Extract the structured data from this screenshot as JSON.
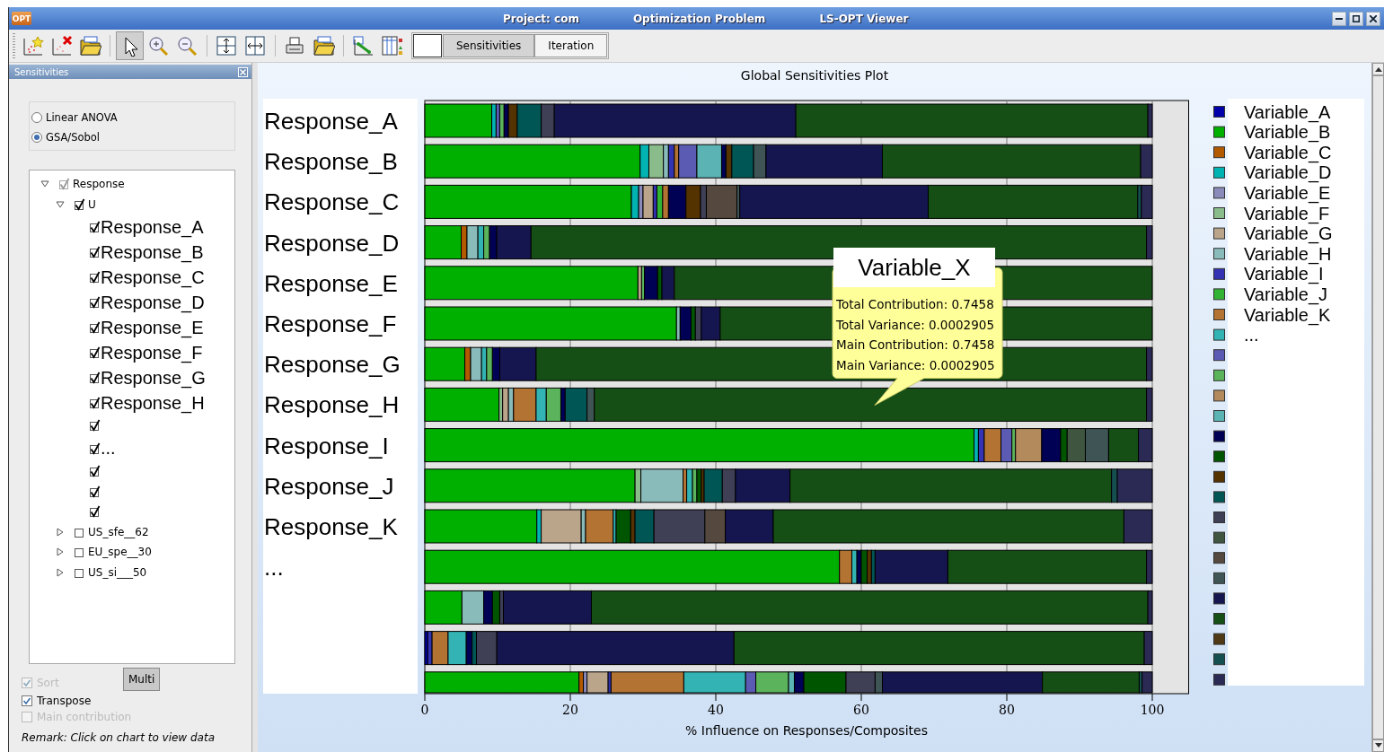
{
  "window": {
    "app_icon": "OPT",
    "title_parts": [
      "Project: com",
      "Optimization Problem",
      "LS-OPT Viewer"
    ]
  },
  "toolbar": {
    "tool_groups": [
      [
        {
          "kind": "add-chart",
          "selected": false
        },
        {
          "kind": "delete-chart",
          "selected": false
        },
        {
          "kind": "open-folder",
          "selected": false
        }
      ],
      [
        {
          "kind": "pointer",
          "selected": true
        },
        {
          "kind": "zoom-in",
          "selected": false
        },
        {
          "kind": "zoom-out",
          "selected": false
        }
      ],
      [
        {
          "kind": "fit-vertical",
          "selected": false
        },
        {
          "kind": "fit-horizontal",
          "selected": false
        }
      ],
      [
        {
          "kind": "print",
          "selected": false
        },
        {
          "kind": "export",
          "selected": false
        }
      ],
      [
        {
          "kind": "graph",
          "selected": false
        },
        {
          "kind": "table",
          "selected": false
        }
      ]
    ],
    "tabs": [
      {
        "label": "Sensitivities",
        "selected": true
      },
      {
        "label": "Iteration",
        "selected": false
      }
    ]
  },
  "side_panel": {
    "title": "Sensitivities",
    "methods": [
      {
        "label": "Linear ANOVA",
        "selected": false
      },
      {
        "label": "GSA/Sobol",
        "selected": true
      }
    ],
    "tree": [
      {
        "label": "Response",
        "checked": true,
        "disabled": true,
        "expanded": true,
        "children": [
          {
            "label": "U",
            "checked": true,
            "disabled": false,
            "expanded": true,
            "children": [
              {
                "label": "Response_A",
                "checked": true
              },
              {
                "label": "Response_B",
                "checked": true
              },
              {
                "label": "Response_C",
                "checked": true
              },
              {
                "label": "Response_D",
                "checked": true
              },
              {
                "label": "Response_E",
                "checked": true
              },
              {
                "label": "Response_F",
                "checked": true
              },
              {
                "label": "Response_G",
                "checked": true
              },
              {
                "label": "Response_H",
                "checked": true
              },
              {
                "checked": true
              },
              {
                "label": "...",
                "checked": true
              },
              {
                "checked": true
              },
              {
                "checked": true
              },
              {
                "checked": true
              }
            ]
          },
          {
            "label": "US_sfe__62",
            "checked": false,
            "disabled": false,
            "expanded": false
          },
          {
            "label": "EU_spe__30",
            "checked": false,
            "disabled": false,
            "expanded": false
          },
          {
            "label": "US_si___50",
            "checked": false,
            "disabled": false,
            "expanded": false
          }
        ]
      }
    ],
    "options": [
      {
        "label": "Sort",
        "checked": true,
        "disabled": true
      },
      {
        "label": "Transpose",
        "checked": true,
        "disabled": false
      },
      {
        "label": "Main contribution",
        "checked": false,
        "disabled": true
      }
    ],
    "multi_button": "Multi",
    "remark": "Remark: Click on chart to view data"
  },
  "plot": {
    "bar_labels": [
      "Response_A",
      "Response_B",
      "Response_C",
      "Response_D",
      "Response_E",
      "Response_F",
      "Response_G",
      "Response_H",
      "Response_I",
      "Response_J",
      "Response_K",
      "..."
    ],
    "chart_data": {
      "type": "bar",
      "orientation": "horizontal",
      "stacked": true,
      "grid": true,
      "legend": "right",
      "title": "Global Sensitivities Plot",
      "xlabel": "% Influence on Responses/Composites",
      "xlim": [
        0,
        105
      ],
      "xticks": [
        0,
        20,
        40,
        60,
        80,
        100
      ],
      "series": [
        {
          "name": "Variable_A",
          "color": "#0000aa",
          "values": [
            0,
            0,
            0,
            0,
            0,
            0,
            0,
            0,
            0,
            0,
            0,
            0,
            0,
            0.4,
            0
          ]
        },
        {
          "name": "Variable_B",
          "color": "#00b000",
          "values": [
            9.2,
            29.6,
            28.4,
            5,
            29.3,
            34.6,
            5.5,
            10.2,
            75.5,
            28.9,
            15.4,
            57,
            5.1,
            0,
            21.2
          ]
        },
        {
          "name": "Variable_C",
          "color": "#b35900",
          "values": [
            0,
            0,
            0,
            0.8,
            0,
            0,
            0.8,
            0,
            0,
            0,
            0,
            0,
            0,
            0,
            0.6
          ]
        },
        {
          "name": "Variable_D",
          "color": "#00b3b3",
          "values": [
            0.6,
            1.2,
            1,
            0,
            0,
            0,
            0,
            0,
            0.6,
            0,
            0.6,
            0,
            0,
            0,
            0
          ]
        },
        {
          "name": "Variable_E",
          "color": "#8a8abb",
          "values": [
            0,
            0,
            0.6,
            0,
            0,
            0,
            0,
            0,
            0,
            0,
            0,
            0,
            0,
            0,
            0.5
          ]
        },
        {
          "name": "Variable_F",
          "color": "#8abb8a",
          "values": [
            0,
            2,
            0,
            0,
            0,
            0,
            0,
            0.5,
            0,
            0.8,
            0,
            0,
            0,
            0,
            0
          ]
        },
        {
          "name": "Variable_G",
          "color": "#bba58a",
          "values": [
            0,
            0,
            1.4,
            0,
            0.5,
            0,
            0,
            0.8,
            0,
            0,
            5.5,
            0,
            0,
            0,
            2.9
          ]
        },
        {
          "name": "Variable_H",
          "color": "#8abbbb",
          "values": [
            0,
            0.7,
            0,
            1.5,
            0,
            0.5,
            1.5,
            0.7,
            0,
            5.8,
            0.6,
            0,
            3,
            0,
            0
          ]
        },
        {
          "name": "Variable_I",
          "color": "#3333b3",
          "values": [
            0,
            0.8,
            0.5,
            0,
            0,
            0,
            0,
            0,
            0.8,
            0,
            0,
            0,
            0,
            0.6,
            0.4
          ]
        },
        {
          "name": "Variable_J",
          "color": "#33b333",
          "values": [
            0,
            0,
            0.8,
            0,
            0,
            0,
            0,
            0,
            0,
            0,
            0,
            0,
            0,
            0,
            0
          ]
        },
        {
          "name": "Variable_K",
          "color": "#b37333",
          "values": [
            0,
            0.6,
            0.8,
            0,
            0,
            0,
            0,
            3.1,
            2.3,
            0.5,
            3.8,
            1.7,
            0,
            2.2,
            10
          ]
        },
        {
          "name": "...",
          "color": "#33b3b3",
          "values": [
            0,
            0,
            0,
            0.8,
            0,
            0,
            0.7,
            1.4,
            0,
            0.8,
            0.4,
            0.7,
            0,
            2.5,
            8.5
          ]
        },
        {
          "color": "#5b5bb3",
          "values": [
            0.5,
            2.5,
            0,
            0,
            0,
            0,
            0,
            0,
            1.5,
            0,
            0,
            0,
            0,
            0,
            1.4
          ]
        },
        {
          "color": "#5bb35b",
          "values": [
            0.6,
            0,
            0,
            0.8,
            0.4,
            0,
            0.8,
            2,
            0.5,
            0.6,
            0,
            0,
            0,
            0,
            4.5
          ]
        },
        {
          "color": "#b38a5b",
          "values": [
            0,
            0,
            0,
            0,
            0,
            0,
            0,
            0,
            3.6,
            0,
            0,
            0,
            0,
            0,
            0
          ]
        },
        {
          "color": "#5bb3b3",
          "values": [
            0,
            3.4,
            0,
            0,
            0,
            0,
            0,
            0,
            0,
            0,
            0,
            0,
            0,
            0,
            0.8
          ]
        },
        {
          "color": "#000055",
          "values": [
            0.6,
            0.6,
            2.4,
            1,
            1.8,
            1.5,
            1,
            0.6,
            2.6,
            0,
            0,
            0.6,
            1.2,
            0.8,
            1.3
          ]
        },
        {
          "color": "#005500",
          "values": [
            0,
            0,
            0,
            0,
            0.6,
            0.6,
            0,
            0,
            0.9,
            0.6,
            2,
            0.8,
            1,
            0,
            5.8
          ]
        },
        {
          "color": "#553300",
          "values": [
            1.2,
            0.8,
            2,
            0,
            0,
            0,
            0,
            0,
            0,
            0.4,
            0.6,
            0.6,
            0,
            0,
            0
          ]
        },
        {
          "color": "#005555",
          "values": [
            3.3,
            3,
            0,
            0,
            0,
            0,
            0,
            3,
            0,
            2.5,
            2.6,
            0.5,
            0,
            0.6,
            0
          ]
        },
        {
          "color": "#3f3f55",
          "values": [
            1.8,
            0,
            0.8,
            0,
            0,
            0.8,
            0,
            0,
            0,
            1.8,
            7,
            0,
            0.5,
            2.8,
            4
          ]
        },
        {
          "color": "#3f553f",
          "values": [
            0,
            0,
            0,
            0,
            0,
            0,
            0,
            0,
            2.5,
            0,
            0,
            0,
            0,
            0,
            0
          ]
        },
        {
          "color": "#55493f",
          "values": [
            0,
            0,
            4.2,
            0,
            0,
            0,
            0,
            0,
            0,
            0,
            2.8,
            0,
            0,
            0,
            0
          ]
        },
        {
          "color": "#3f5555",
          "values": [
            0,
            1.7,
            0.4,
            0,
            0,
            0,
            0,
            1,
            3.2,
            0,
            0,
            0,
            0,
            0,
            1
          ]
        },
        {
          "color": "#15154f",
          "values": [
            33.2,
            16,
            25.9,
            4.7,
            1.7,
            2.6,
            5,
            0,
            0,
            7.5,
            6.6,
            10,
            12.1,
            32.6,
            22
          ]
        },
        {
          "color": "#154f15",
          "values": [
            48.4,
            35.5,
            28.8,
            84.6,
            65.7,
            59.4,
            83.9,
            75.9,
            4.1,
            44.2,
            48.2,
            27.3,
            76.5,
            56.4,
            13.3
          ]
        },
        {
          "color": "#4f3a15",
          "values": [
            0,
            0,
            0,
            0,
            0,
            0,
            0,
            0,
            0,
            0,
            0,
            0,
            0,
            0,
            0
          ]
        },
        {
          "color": "#154f4f",
          "values": [
            0,
            0,
            0.5,
            0,
            0,
            0,
            0,
            0,
            0,
            0.8,
            0,
            0,
            0,
            0,
            0.4
          ]
        },
        {
          "color": "#2a2a55",
          "values": [
            0.6,
            1.6,
            1.5,
            0.8,
            0,
            0,
            0.8,
            0.8,
            1.9,
            4.8,
            3.9,
            0.8,
            0.6,
            1.1,
            1.4
          ]
        }
      ]
    },
    "tooltip": {
      "title": "Variable_X",
      "lines": [
        "Total Contribution: 0.7458",
        "Total Variance: 0.0002905",
        "Main Contribution: 0.7458",
        "Main Variance: 0.0002905"
      ]
    }
  }
}
